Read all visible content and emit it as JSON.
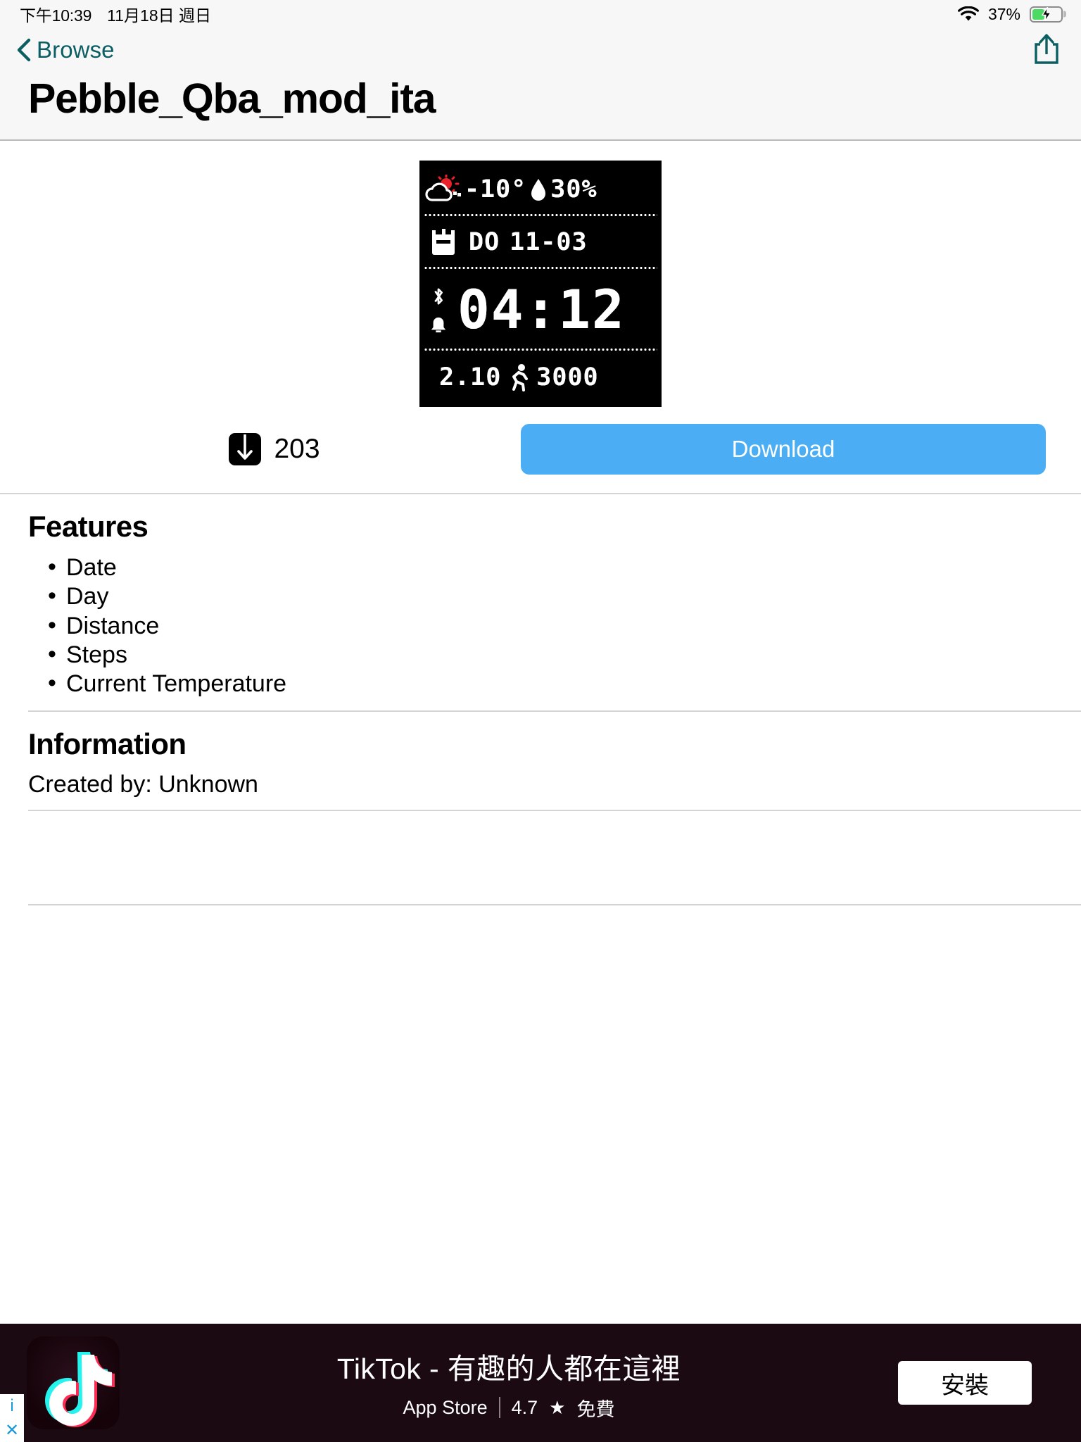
{
  "statusbar": {
    "time": "下午10:39",
    "date": "11月18日 週日",
    "wifi_icon": "wifi-icon",
    "battery_percent": "37%",
    "battery_icon": "battery-charging-icon",
    "battery_level": 37
  },
  "navbar": {
    "back_label": "Browse",
    "back_icon": "chevron-left-icon",
    "share_icon": "share-icon"
  },
  "header": {
    "title": "Pebble_Qba_mod_ita"
  },
  "preview": {
    "alt": "watchface-preview",
    "row1": {
      "weather_icon": "sun-behind-cloud-icon",
      "temperature": "-10°",
      "humidity_icon": "droplet-icon",
      "humidity": "30%"
    },
    "row2": {
      "calendar_icon": "calendar-icon",
      "day": "DO",
      "date": "11-03"
    },
    "row3": {
      "bluetooth_icon": "bluetooth-icon",
      "bell_icon": "bell-icon",
      "time": "04:12"
    },
    "row4": {
      "distance": "2.10",
      "steps_icon": "running-person-icon",
      "steps": "3000"
    }
  },
  "actions": {
    "download_count_icon": "download-icon",
    "download_count": "203",
    "download_button_label": "Download",
    "download_button_color": "#4badf3"
  },
  "features": {
    "title": "Features",
    "items": [
      "Date",
      "Day",
      "Distance",
      "Steps",
      "Current Temperature"
    ]
  },
  "information": {
    "title": "Information",
    "created_by": "Created by: Unknown"
  },
  "ad": {
    "info_badge": "i",
    "close_badge": "✕",
    "logo_icon": "tiktok-logo-icon",
    "title": "TikTok - 有趣的人都在這裡",
    "store": "App Store",
    "rating": "4.7",
    "star_icon": "★",
    "price": "免費",
    "install_label": "安裝",
    "background_color": "#1b0a12"
  }
}
